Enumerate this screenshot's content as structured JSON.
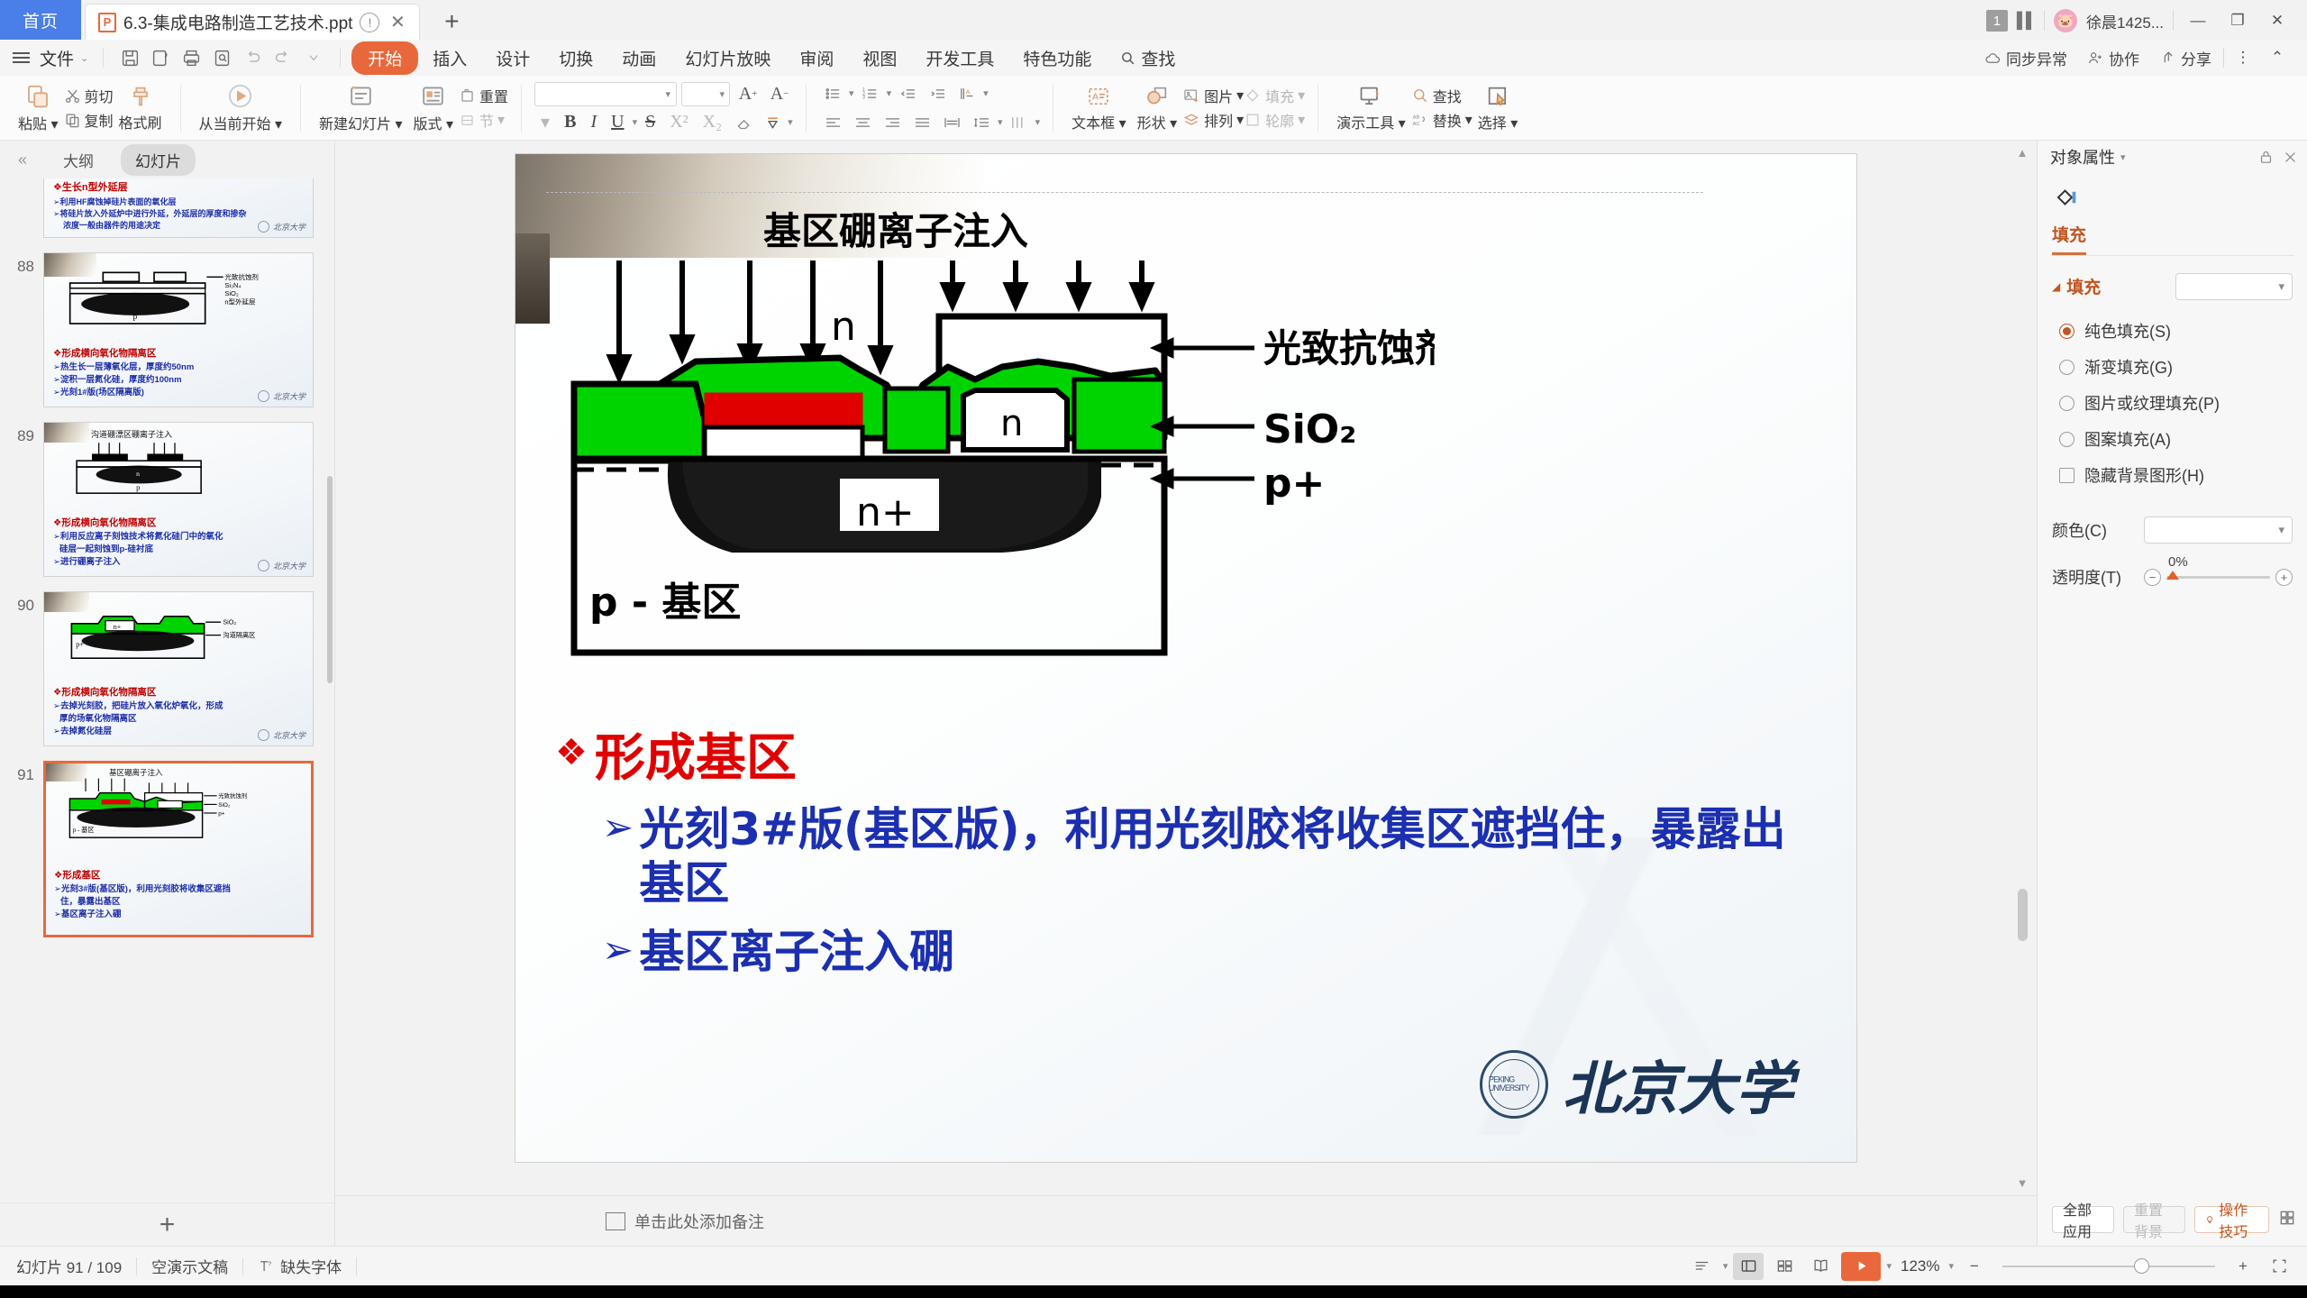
{
  "tabbar": {
    "home_label": "首页",
    "doc_name": "6.3-集成电路制造工艺技术.ppt",
    "doc_icon_letter": "P",
    "warn_icon": "warning-circle-icon",
    "close_icon": "close-icon",
    "new_tab_icon": "plus-icon",
    "page_badge": "1",
    "user_name": "徐晨1425...",
    "minimize": "—",
    "restore": "❐",
    "close": "✕"
  },
  "ribbon": {
    "file_label": "文件",
    "quick_icons": [
      "save-icon",
      "save-as-icon",
      "print-icon",
      "print-preview-icon",
      "undo-icon",
      "redo-icon",
      "customize-icon"
    ],
    "tabs": [
      {
        "label": "开始",
        "active": true
      },
      {
        "label": "插入",
        "active": false
      },
      {
        "label": "设计",
        "active": false
      },
      {
        "label": "切换",
        "active": false
      },
      {
        "label": "动画",
        "active": false
      },
      {
        "label": "幻灯片放映",
        "active": false
      },
      {
        "label": "审阅",
        "active": false
      },
      {
        "label": "视图",
        "active": false
      },
      {
        "label": "开发工具",
        "active": false
      },
      {
        "label": "特色功能",
        "active": false
      },
      {
        "label": "查找",
        "active": false
      }
    ],
    "right_items": [
      {
        "label": "同步异常",
        "icon": "cloud-warning-icon"
      },
      {
        "label": "协作",
        "icon": "collaborate-icon"
      },
      {
        "label": "分享",
        "icon": "share-icon"
      }
    ],
    "more_icon": "more-vertical-icon",
    "collapse_icon": "chevron-up-icon"
  },
  "toolbar": {
    "paste": "粘贴",
    "cut": "剪切",
    "copy": "复制",
    "format_painter": "格式刷",
    "start_from_current": "从当前开始",
    "new_slide": "新建幻灯片",
    "layout": "版式",
    "reset": "重置",
    "section": "节",
    "font_name": "",
    "font_size": "",
    "grow_font": "A",
    "shrink_font": "A",
    "bold": "B",
    "italic": "I",
    "underline": "U",
    "strike": "S",
    "superscript": "X²",
    "subscript": "X₂",
    "clear_format": "clear-format-icon",
    "phonetic": "phonetic-icon",
    "bullets_icon": "bulleted-list-icon",
    "numbering_icon": "numbered-list-icon",
    "decrease_indent_icon": "decrease-indent-icon",
    "increase_indent_icon": "increase-indent-icon",
    "text_direction_icon": "text-direction-icon",
    "align_left_icon": "align-left-icon",
    "align_center_icon": "align-center-icon",
    "align_right_icon": "align-right-icon",
    "justify_icon": "justify-icon",
    "distribute_icon": "distribute-icon",
    "line_spacing_icon": "line-spacing-icon",
    "columns_icon": "columns-icon",
    "text_box": "文本框",
    "shapes": "形状",
    "picture": "图片",
    "fill": "填充",
    "arrange": "排列",
    "outline": "轮廓",
    "present_tools": "演示工具",
    "find": "查找",
    "replace": "替换",
    "select": "选择"
  },
  "thumbnails": {
    "collapse_icon": "double-chevron-left-icon",
    "tab_outline": "大纲",
    "tab_slides": "幻灯片",
    "add_slide_icon": "plus-icon",
    "items": [
      {
        "number": "",
        "active": false,
        "title": "❖生长n型外延层",
        "lines": [
          "➢利用HF腐蚀掉硅片表面的氧化层",
          "➢将硅片放入外延炉中进行外延，外延层的厚度和掺杂",
          "浓度一般由器件的用途决定"
        ],
        "pku": "北京大学"
      },
      {
        "number": "88",
        "active": false,
        "title": "❖形成横向氧化物隔离区",
        "lines": [
          "➢热生长一层薄氧化层，厚度约50nm",
          "➢淀积一层氮化硅，厚度约100nm",
          "➢光刻1#版(场区隔离版)"
        ],
        "diagram_labels": [
          "光致抗蚀剂",
          "Si₃N₄",
          "SiO₂",
          "n型外延层",
          "p"
        ],
        "pku": "北京大学"
      },
      {
        "number": "89",
        "active": false,
        "title": "❖形成横向氧化物隔离区",
        "lines": [
          "➢利用反应离子刻蚀技术将氮化硅门中的氧化",
          "硅层一起刻蚀到p-硅衬底",
          "➢进行硼离子注入"
        ],
        "diagram_labels": [
          "沟道硼漂区硼离子注入",
          "n",
          "p"
        ],
        "pku": "北京大学"
      },
      {
        "number": "90",
        "active": false,
        "title": "❖形成横向氧化物隔离区",
        "lines": [
          "➢去掉光刻胶，把硅片放入氧化炉氧化，形成",
          "厚的场氧化物隔离区",
          "➢去掉氮化硅层"
        ],
        "diagram_labels": [
          "SiO₂",
          "沟道隔离区",
          "p+",
          "n+"
        ],
        "pku": "北京大学"
      },
      {
        "number": "91",
        "active": true,
        "title": "❖形成基区",
        "lines": [
          "➢光刻3#版(基区版)，利用光刻胶将收集区遮挡",
          "住，暴露出基区",
          "➢基区离子注入硼"
        ],
        "diagram_labels": [
          "基区硼离子注入",
          "光致抗蚀剂",
          "SiO₂",
          "p+",
          "p-基区"
        ],
        "pku": "北京大学"
      }
    ]
  },
  "slide": {
    "diagram": {
      "top_label": "基区硼离子注入",
      "right_labels": [
        "光致抗蚀剂",
        "SiO₂",
        "p+"
      ],
      "inner_labels": [
        "n",
        "n",
        "n+",
        "p - 基区"
      ]
    },
    "heading": "形成基区",
    "heading_bullet": "❖",
    "bullets": [
      {
        "marker": "➢",
        "text": "光刻3#版(基区版)，利用光刻胶将收集区遮挡住，暴露出基区"
      },
      {
        "marker": "➢",
        "text": "基区离子注入硼"
      }
    ],
    "logo_text": "北京大学",
    "logo_seal": "PEKING UNIVERSITY"
  },
  "notes": {
    "icon": "notes-icon",
    "placeholder": "单击此处添加备注"
  },
  "rightpanel": {
    "title": "对象属性",
    "title_caret": "▾",
    "lock_icon": "lock-icon",
    "close_icon": "close-icon",
    "shape_icon": "shape-fill-icon",
    "tab_fill": "填充",
    "section_fill": "填充",
    "fill_combo_value": "",
    "options": [
      {
        "label": "纯色填充(S)",
        "type": "radio",
        "selected": true
      },
      {
        "label": "渐变填充(G)",
        "type": "radio",
        "selected": false
      },
      {
        "label": "图片或纹理填充(P)",
        "type": "radio",
        "selected": false
      },
      {
        "label": "图案填充(A)",
        "type": "radio",
        "selected": false
      },
      {
        "label": "隐藏背景图形(H)",
        "type": "checkbox",
        "selected": false
      }
    ],
    "color_label": "颜色(C)",
    "color_value": "",
    "transparency_label": "透明度(T)",
    "transparency_value": "0%",
    "apply_all": "全部应用",
    "reset_bg": "重置背景",
    "tips": "操作技巧",
    "tips_icon": "lightbulb-icon",
    "grid_icon": "grid-icon",
    "side_toggle_icon": "sliders-icon",
    "accent_color": "#c05621"
  },
  "statusbar": {
    "slide_counter": "幻灯片 91 / 109",
    "presentation": "空演示文稿",
    "missing_font": "缺失字体",
    "missing_font_icon": "font-warning-icon",
    "view_icons": [
      "outline-view-icon",
      "normal-view-icon",
      "slide-sorter-icon",
      "reading-view-icon"
    ],
    "active_view": "normal-view-icon",
    "play_icon": "play-icon",
    "zoom_level": "123%",
    "zoom_minus": "−",
    "zoom_plus": "+",
    "fit_icon": "fit-to-window-icon"
  }
}
